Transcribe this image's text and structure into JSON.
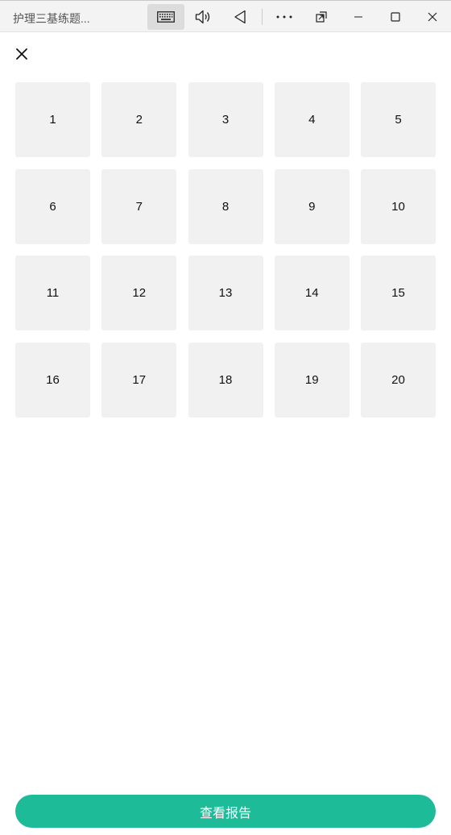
{
  "window": {
    "title": "护理三基练题...",
    "toolbar_icons": [
      "keyboard-icon",
      "speaker-icon",
      "back-triangle-icon",
      "more-icon",
      "restore-window-icon",
      "minimize-icon",
      "maximize-icon",
      "close-icon"
    ]
  },
  "close_icon": "close-icon",
  "questions": [
    "1",
    "2",
    "3",
    "4",
    "5",
    "6",
    "7",
    "8",
    "9",
    "10",
    "11",
    "12",
    "13",
    "14",
    "15",
    "16",
    "17",
    "18",
    "19",
    "20"
  ],
  "report_button_label": "查看报告",
  "colors": {
    "accent": "#1dbb98",
    "cell_bg": "#f1f1f1",
    "titlebar_bg": "#f3f3f3"
  }
}
